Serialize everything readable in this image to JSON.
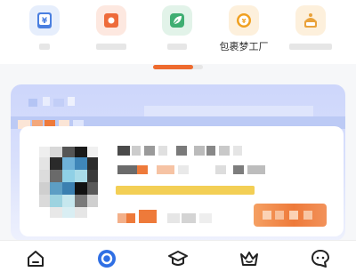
{
  "shortcuts": [
    {
      "label": "",
      "icon": "tax-document-icon",
      "color": "#4a7fe0"
    },
    {
      "label": "",
      "icon": "record-icon",
      "color": "#ee6b3a"
    },
    {
      "label": "",
      "icon": "leaf-icon",
      "color": "#3fae72"
    },
    {
      "label": "包裹梦工厂",
      "icon": "coin-icon",
      "color": "#f0a020"
    },
    {
      "label": "",
      "icon": "cake-icon",
      "color": "#e9a23b"
    }
  ],
  "pager": {
    "progress": 0.8
  },
  "card": {
    "progress": 1.0,
    "accent": "#ee7a3a",
    "background": "#cdd6fb"
  },
  "nav": [
    {
      "name": "home",
      "icon": "home-icon",
      "active": false
    },
    {
      "name": "discover",
      "icon": "target-icon",
      "active": true
    },
    {
      "name": "learn",
      "icon": "graduation-cap-icon",
      "active": false
    },
    {
      "name": "member",
      "icon": "crown-icon",
      "active": false
    },
    {
      "name": "support",
      "icon": "chat-icon",
      "active": false
    }
  ]
}
